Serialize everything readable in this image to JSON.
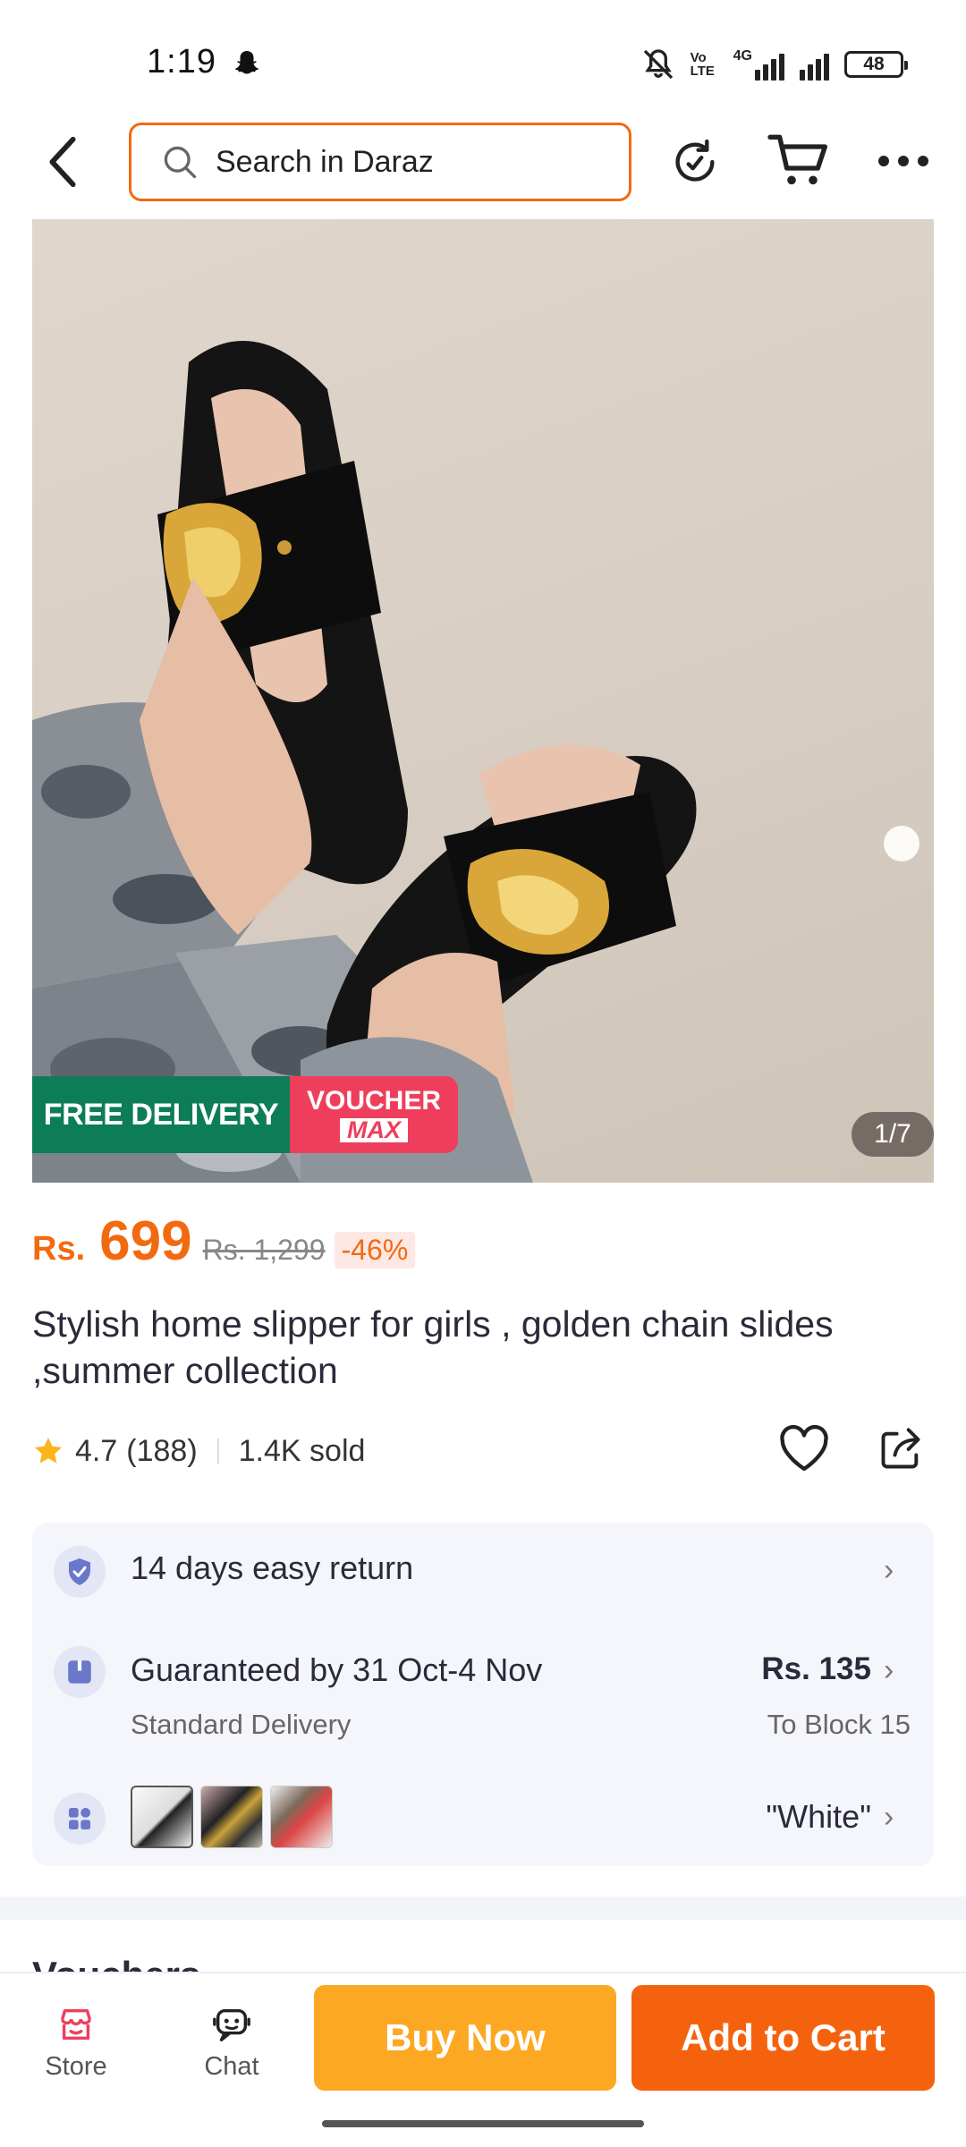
{
  "status_bar": {
    "time": "1:19",
    "battery": "48",
    "network_label": "Vo LTE",
    "network_type": "4G",
    "icons": [
      "snapchat-icon",
      "mute-icon",
      "volte-icon",
      "signal-icon",
      "signal-icon",
      "battery-icon"
    ]
  },
  "header": {
    "search_placeholder": "Search in Daraz",
    "icons": [
      "back-icon",
      "search-icon",
      "reload-icon",
      "cart-icon",
      "more-icon"
    ]
  },
  "gallery": {
    "badge_free_delivery": "FREE DELIVERY",
    "badge_voucher_line1": "VOUCHER",
    "badge_voucher_line2": "MAX",
    "counter": "1/7"
  },
  "product": {
    "currency": "Rs.",
    "price": "699",
    "original_price": "Rs. 1,299",
    "discount": "-46%",
    "title": "Stylish home slipper for girls , golden chain slides ,summer collection",
    "rating": "4.7",
    "rating_count": "(188)",
    "sold": "1.4K sold"
  },
  "services": {
    "return": "14 days easy return",
    "delivery_title": "Guaranteed by 31 Oct-4 Nov",
    "delivery_type": "Standard Delivery",
    "delivery_fee": "Rs. 135",
    "delivery_destination": "To Block 15",
    "variant_selected": "\"White\""
  },
  "next_section_peek": "Vouchers",
  "bottom_bar": {
    "store_label": "Store",
    "chat_label": "Chat",
    "buy_now": "Buy Now",
    "add_to_cart": "Add to Cart"
  },
  "colors": {
    "accent": "#f26a10",
    "buy_now": "#fca823",
    "add_to_cart": "#f5620e",
    "free_delivery": "#0c7d57",
    "voucher": "#ef3e5c"
  }
}
